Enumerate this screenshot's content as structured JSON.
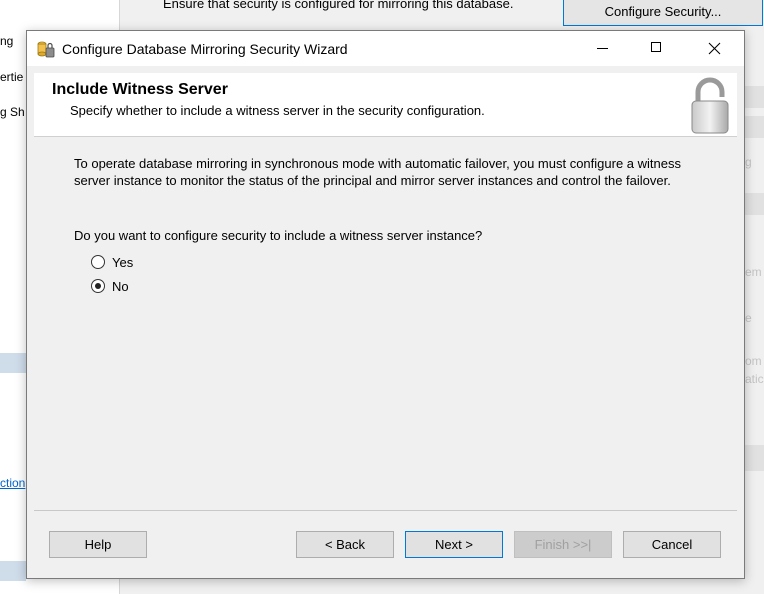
{
  "background": {
    "left_labels": [
      "ng",
      "ertie",
      "g Sh"
    ],
    "link_text": "ction",
    "top_text": "Ensure that security is configured for mirroring this database.",
    "configure_button": "Configure Security...",
    "ghost_labels": [
      "g",
      "em",
      "e",
      "om",
      "atic"
    ]
  },
  "window": {
    "title": "Configure Database Mirroring Security Wizard"
  },
  "header": {
    "title": "Include Witness Server",
    "subtitle": "Specify whether to include a witness server in the security configuration."
  },
  "content": {
    "description": "To operate database mirroring in synchronous mode with automatic failover, you must configure a witness server instance to monitor the status of the principal and mirror server instances and control the failover.",
    "question": "Do you want to configure security to include a witness server instance?",
    "options": [
      {
        "label": "Yes",
        "selected": false
      },
      {
        "label": "No",
        "selected": true
      }
    ]
  },
  "buttons": {
    "help": "Help",
    "back": "< Back",
    "next": "Next >",
    "finish": "Finish >>|",
    "cancel": "Cancel"
  },
  "colors": {
    "accent": "#0078d7",
    "dialog_bg": "#f0f0f0",
    "link": "#0066cc"
  }
}
